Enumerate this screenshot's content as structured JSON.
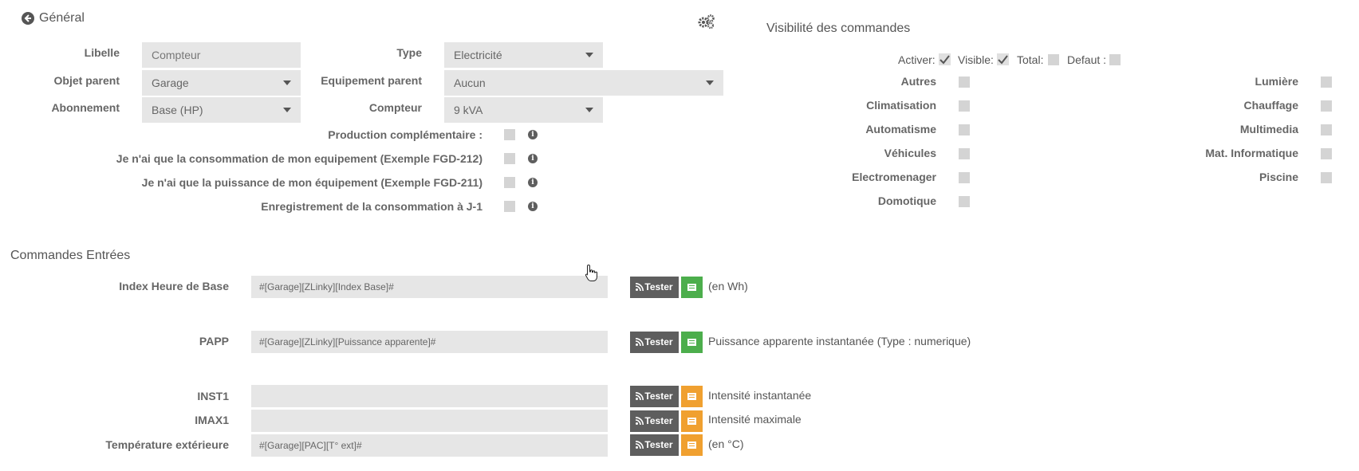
{
  "general": {
    "title": "Général",
    "labels": {
      "libelle": "Libelle",
      "objet_parent": "Objet parent",
      "abonnement": "Abonnement",
      "type": "Type",
      "equipement_parent": "Equipement parent",
      "compteur": "Compteur"
    },
    "fields": {
      "libelle_placeholder": "Compteur",
      "objet_parent": "Garage",
      "abonnement": "Base (HP)",
      "type": "Electricité",
      "equipement_parent": "Aucun",
      "compteur": "9 kVA"
    },
    "options": [
      {
        "label": "Production complémentaire :",
        "checked": false
      },
      {
        "label": "Je n'ai que la consommation de mon equipement (Exemple FGD-212)",
        "checked": false
      },
      {
        "label": "Je n'ai que la puissance de mon équipement (Exemple FGD-211)",
        "checked": false
      },
      {
        "label": "Enregistrement de la consommation à J-1",
        "checked": false
      }
    ]
  },
  "visibility": {
    "title": "Visibilité des commandes",
    "top": {
      "activer": "Activer:",
      "visible": "Visible:",
      "total": "Total:",
      "defaut": "Defaut :"
    },
    "left": [
      "Autres",
      "Climatisation",
      "Automatisme",
      "Véhicules",
      "Electromenager",
      "Domotique"
    ],
    "right": [
      "Lumière",
      "Chauffage",
      "Multimedia",
      "Mat. Informatique",
      "Piscine"
    ]
  },
  "commands": {
    "title": "Commandes Entrées",
    "tester_label": "Tester",
    "rows": [
      {
        "label": "Index Heure de Base",
        "value": "#[Garage][ZLinky][Index Base]#",
        "description": "(en Wh)",
        "status": "green"
      },
      {
        "label": "PAPP",
        "value": "#[Garage][ZLinky][Puissance apparente]#",
        "description": "Puissance apparente instantanée (Type : numerique)",
        "status": "green"
      },
      {
        "label": "INST1",
        "value": "",
        "description": "Intensité instantanée",
        "status": "orange"
      },
      {
        "label": "IMAX1",
        "value": "",
        "description": "Intensité maximale",
        "status": "orange"
      },
      {
        "label": "Température extérieure",
        "value": "#[Garage][PAC][T° ext]#",
        "description": "(en °C)",
        "status": "orange"
      }
    ]
  },
  "colors": {
    "accent_green": "#4cae4c",
    "accent_orange": "#f0a030",
    "button_dark": "#5e5e5e",
    "field_bg": "#e6e6e6"
  }
}
